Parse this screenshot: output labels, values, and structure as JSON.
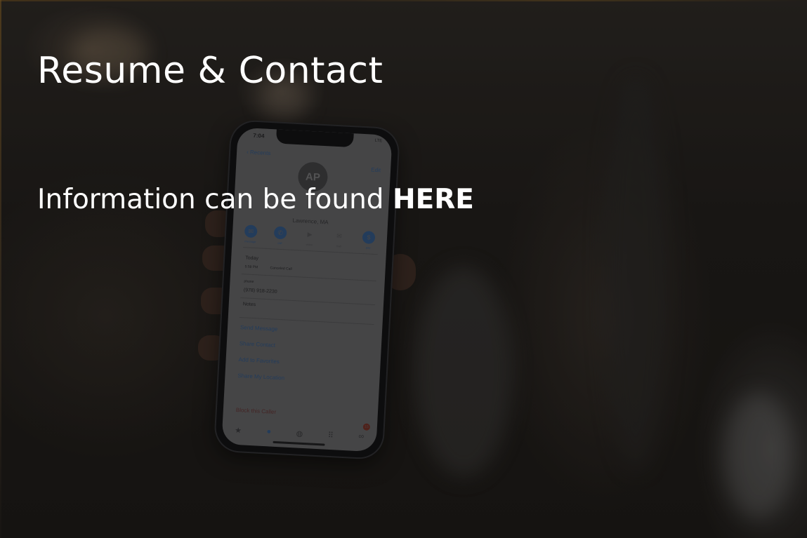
{
  "headline": "Resume & Contact",
  "subline": {
    "text": "Information can be found",
    "link_label": "HERE"
  },
  "phone": {
    "status_time": "7:04",
    "status_right": "LTE",
    "back_label": "Recents",
    "edit_label": "Edit",
    "avatar_initials": "AP",
    "location": "Lawrence, MA",
    "actions": [
      {
        "label": "message",
        "icon": "message-icon"
      },
      {
        "label": "call",
        "icon": "phone-icon"
      },
      {
        "label": "video",
        "icon": "video-icon"
      },
      {
        "label": "mail",
        "icon": "mail-icon"
      },
      {
        "label": "pay",
        "icon": "dollar-icon"
      }
    ],
    "today_label": "Today",
    "call_time": "5:58 PM",
    "call_status": "Canceled Call",
    "phone_label": "phone",
    "phone_number": "(978) 918-2230",
    "notes_label": "Notes",
    "links": [
      "Send Message",
      "Share Contact",
      "Add to Favorites",
      "Share My Location"
    ],
    "block_label": "Block this Caller",
    "tab_badge": "15",
    "tabs": [
      {
        "name": "favorites-tab",
        "icon": "star-icon",
        "glyph": "★"
      },
      {
        "name": "recents-tab",
        "icon": "clock-icon",
        "glyph": "●"
      },
      {
        "name": "contacts-tab",
        "icon": "people-icon",
        "glyph": "👥"
      },
      {
        "name": "keypad-tab",
        "icon": "keypad-icon",
        "glyph": "⠿"
      },
      {
        "name": "voicemail-tab",
        "icon": "voicemail-icon",
        "glyph": "∞"
      }
    ]
  },
  "colors": {
    "text": "#ffffff",
    "background": "#1e1b18",
    "ios_blue_dimmed": "#2d4f7a"
  }
}
